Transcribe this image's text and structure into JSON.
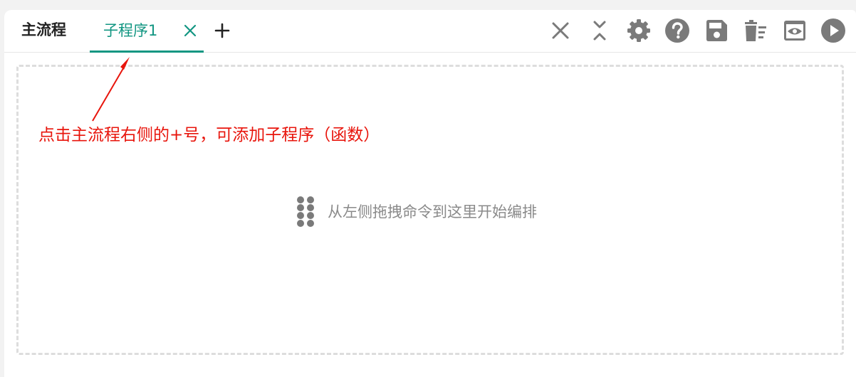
{
  "tabs": {
    "main_label": "主流程",
    "sub_label": "子程序1"
  },
  "toolbar": {
    "icons": [
      "close-icon",
      "collapse-icon",
      "settings-icon",
      "help-icon",
      "save-icon",
      "clear-icon",
      "preview-icon",
      "run-icon"
    ]
  },
  "canvas": {
    "placeholder": "从左侧拖拽命令到这里开始编排"
  },
  "annotation": {
    "text": "点击主流程右侧的+号，可添加子程序（函数）"
  },
  "colors": {
    "accent": "#129682",
    "annotation": "#e8150c",
    "icon": "#7a7a7a"
  }
}
